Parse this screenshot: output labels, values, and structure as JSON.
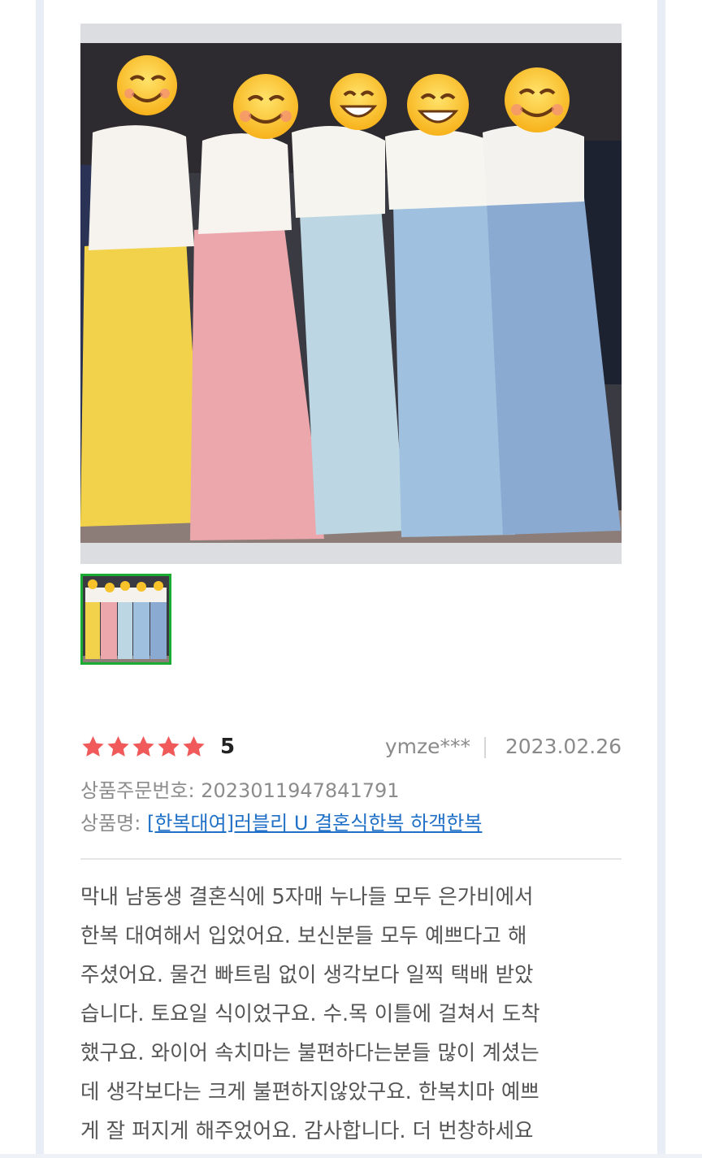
{
  "review": {
    "photos": {
      "main_photo": "review-photo",
      "thumbnails": [
        "review-photo-thumbnail"
      ],
      "selected_thumbnail": 0
    },
    "rating": {
      "stars_filled": 5,
      "stars_total": 5,
      "score": "5",
      "star_color": "#f15a5a"
    },
    "author": "ymze***",
    "date": "2023.02.26",
    "order": {
      "label": "상품주문번호:",
      "number": "2023011947841791"
    },
    "product": {
      "label": "상품명:",
      "name": "[한복대여]러블리 U 결혼식한복 하객한복"
    },
    "body_lines": [
      "막내 남동생 결혼식에 5자매 누나들 모두 은가비에서",
      "한복 대여해서 입었어요. 보신분들 모두 예쁘다고 해",
      "주셨어요. 물건 빠트림 없이 생각보다 일찍 택배 받았",
      "습니다. 토요일 식이었구요. 수.목 이틀에 걸쳐서 도착",
      "했구요. 와이어 속치마는 불편하다는분들 많이 계셨는",
      "데 생각보다는 크게 불편하지않았구요. 한복치마 예쁘",
      "게 잘 퍼지게 해주었어요. 감사합니다. 더 번창하세요"
    ]
  }
}
